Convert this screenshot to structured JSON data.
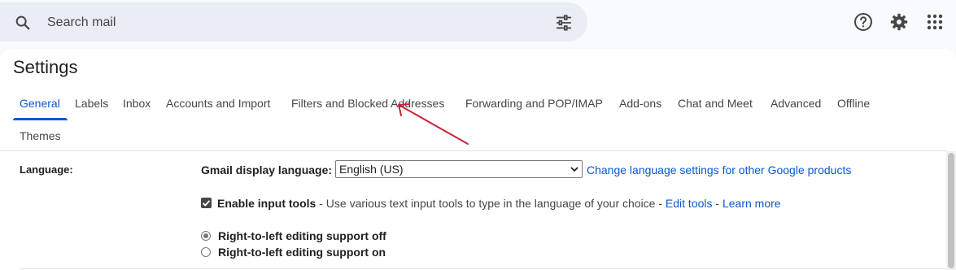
{
  "search": {
    "placeholder": "Search mail"
  },
  "settings": {
    "title": "Settings",
    "tabs": [
      {
        "label": "General",
        "active": true
      },
      {
        "label": "Labels"
      },
      {
        "label": "Inbox"
      },
      {
        "label": "Accounts and Import"
      },
      {
        "label": "Filters and Blocked Addresses"
      },
      {
        "label": "Forwarding and POP/IMAP"
      },
      {
        "label": "Add-ons"
      },
      {
        "label": "Chat and Meet"
      },
      {
        "label": "Advanced"
      },
      {
        "label": "Offline"
      },
      {
        "label": "Themes"
      }
    ]
  },
  "language": {
    "label": "Language:",
    "display_language_label": "Gmail display language:",
    "selected_language": "English (US)",
    "change_link": "Change language settings for other Google products",
    "input_tools": {
      "checked": true,
      "label": "Enable input tools",
      "description": " - Use various text input tools to type in the language of your choice - ",
      "edit_link": "Edit tools",
      "separator": " - ",
      "learn_link": "Learn more"
    },
    "rtl_off": "Right-to-left editing support off",
    "rtl_on": "Right-to-left editing support on",
    "rtl_selected": "off"
  },
  "colors": {
    "accent": "#0b57d0",
    "annotation_arrow": "#c8243a",
    "search_bg": "#e9eef6"
  },
  "icons": [
    "search-icon",
    "tune-icon",
    "help-icon",
    "gear-icon",
    "apps-grid-icon",
    "chevron-down-icon"
  ]
}
